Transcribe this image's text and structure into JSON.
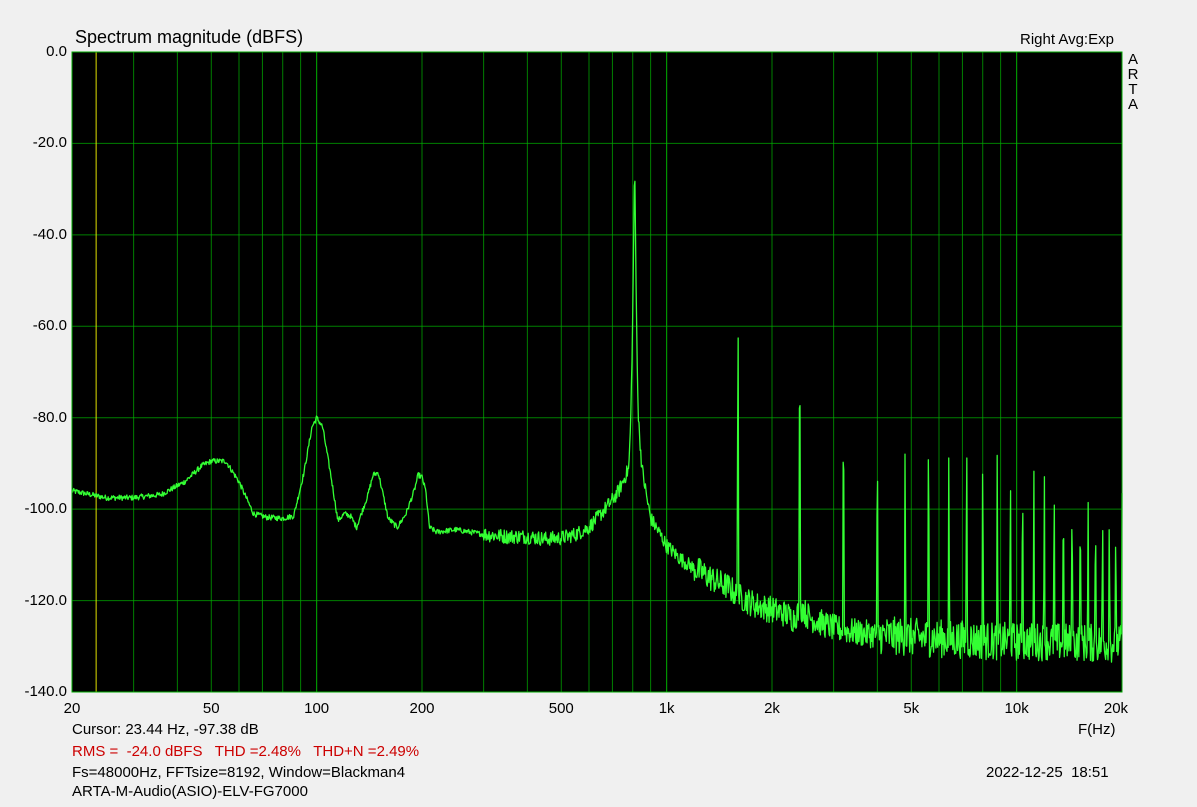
{
  "header": {
    "title": "Spectrum magnitude (dBFS)",
    "channel_info": "Right Avg:Exp",
    "brand_letters": [
      "A",
      "R",
      "T",
      "A"
    ]
  },
  "footer": {
    "cursor": "Cursor: 23.44 Hz, -97.38 dB",
    "stats": "RMS =  -24.0 dBFS   THD =2.48%   THD+N =2.49%",
    "params": "Fs=48000Hz, FFTsize=8192, Window=Blackman4",
    "device": "ARTA-M-Audio(ASIO)-ELV-FG7000",
    "timestamp": "2022-12-25  18:51"
  },
  "colors": {
    "plot_background": "#000000",
    "grid": "#00aa00",
    "trace": "#33ff33",
    "cursor_line": "#e0e000",
    "stats_text": "#cc0000"
  },
  "chart_data": {
    "type": "line",
    "title": "Spectrum magnitude (dBFS)",
    "xlabel": "F(Hz)",
    "ylabel": "",
    "x_scale": "log",
    "xlim": [
      20,
      20000
    ],
    "ylim": [
      -140,
      0
    ],
    "grid": true,
    "y_ticks": [
      0,
      -20,
      -40,
      -60,
      -80,
      -100,
      -120,
      -140
    ],
    "y_tick_labels": [
      "0.0",
      "-20.0",
      "-40.0",
      "-60.0",
      "-80.0",
      "-100.0",
      "-120.0",
      "-140.0"
    ],
    "x_ticks": [
      20,
      50,
      100,
      200,
      500,
      1000,
      2000,
      5000,
      10000,
      20000
    ],
    "x_tick_labels": [
      "20",
      "50",
      "100",
      "200",
      "500",
      "1k",
      "2k",
      "5k",
      "10k",
      "20k"
    ],
    "cursor_x": 23.44,
    "series": [
      {
        "baseline": {
          "x": [
            20,
            25,
            30,
            36,
            42,
            47,
            50,
            55,
            60,
            66,
            72,
            80,
            86,
            92,
            97,
            100,
            104,
            110,
            115,
            120,
            125,
            130,
            140,
            145,
            150,
            155,
            160,
            170,
            180,
            190,
            195,
            200,
            205,
            210,
            220,
            250,
            300,
            350,
            400,
            450,
            500,
            550,
            600,
            650,
            700,
            730,
            760,
            780,
            790,
            800,
            810,
            820,
            830,
            850,
            880,
            900,
            950,
            1000,
            1100,
            1200,
            1300,
            1400,
            1500,
            1550,
            1580,
            1650,
            1700,
            1800,
            2000,
            2200,
            2300,
            2350,
            2450,
            2500,
            2600,
            3000,
            3500,
            4000,
            5000,
            6000,
            7000,
            8000,
            10000,
            12000,
            15000,
            20000
          ],
          "y": [
            -96,
            -97.5,
            -97.5,
            -96.8,
            -94,
            -90.5,
            -89.5,
            -89.5,
            -94,
            -101,
            -101.8,
            -102,
            -101.5,
            -92,
            -82,
            -80,
            -82,
            -93,
            -102.5,
            -101,
            -101.5,
            -104,
            -97,
            -92.5,
            -92,
            -97,
            -102,
            -104,
            -101,
            -96,
            -92.5,
            -93,
            -96,
            -104,
            -105,
            -104.5,
            -105.5,
            -106,
            -106,
            -106.5,
            -106.3,
            -105.5,
            -104,
            -101,
            -98,
            -96,
            -93,
            -91,
            -80,
            -58,
            -24,
            -58,
            -80,
            -91,
            -98,
            -102,
            -105,
            -108,
            -111,
            -113,
            -114.5,
            -116,
            -117,
            -118,
            -119,
            -119.5,
            -120,
            -121,
            -122,
            -123,
            -124,
            -123,
            -121.5,
            -123,
            -124,
            -126,
            -127,
            -127.5,
            -128,
            -128.3,
            -128.5,
            -128.8,
            -129,
            -129,
            -129.2,
            -129.5
          ]
        },
        "harmonics": {
          "frequency": [
            1600,
            2400,
            3200,
            4000,
            4800,
            5600,
            6400,
            7200,
            8000,
            8800,
            9600,
            10400,
            11200,
            12000,
            12800,
            13600,
            14400,
            15200,
            16000,
            16800,
            17600,
            18400,
            19200,
            20000
          ],
          "level": [
            -58,
            -62,
            -75,
            -82,
            -84,
            -80,
            -86,
            -82,
            -85,
            -86,
            -88,
            -88.5,
            -89,
            -89.5,
            -90,
            -91,
            -92,
            -93,
            -94,
            -94.5,
            -95,
            -96,
            -97,
            -96.5
          ]
        }
      }
    ]
  }
}
